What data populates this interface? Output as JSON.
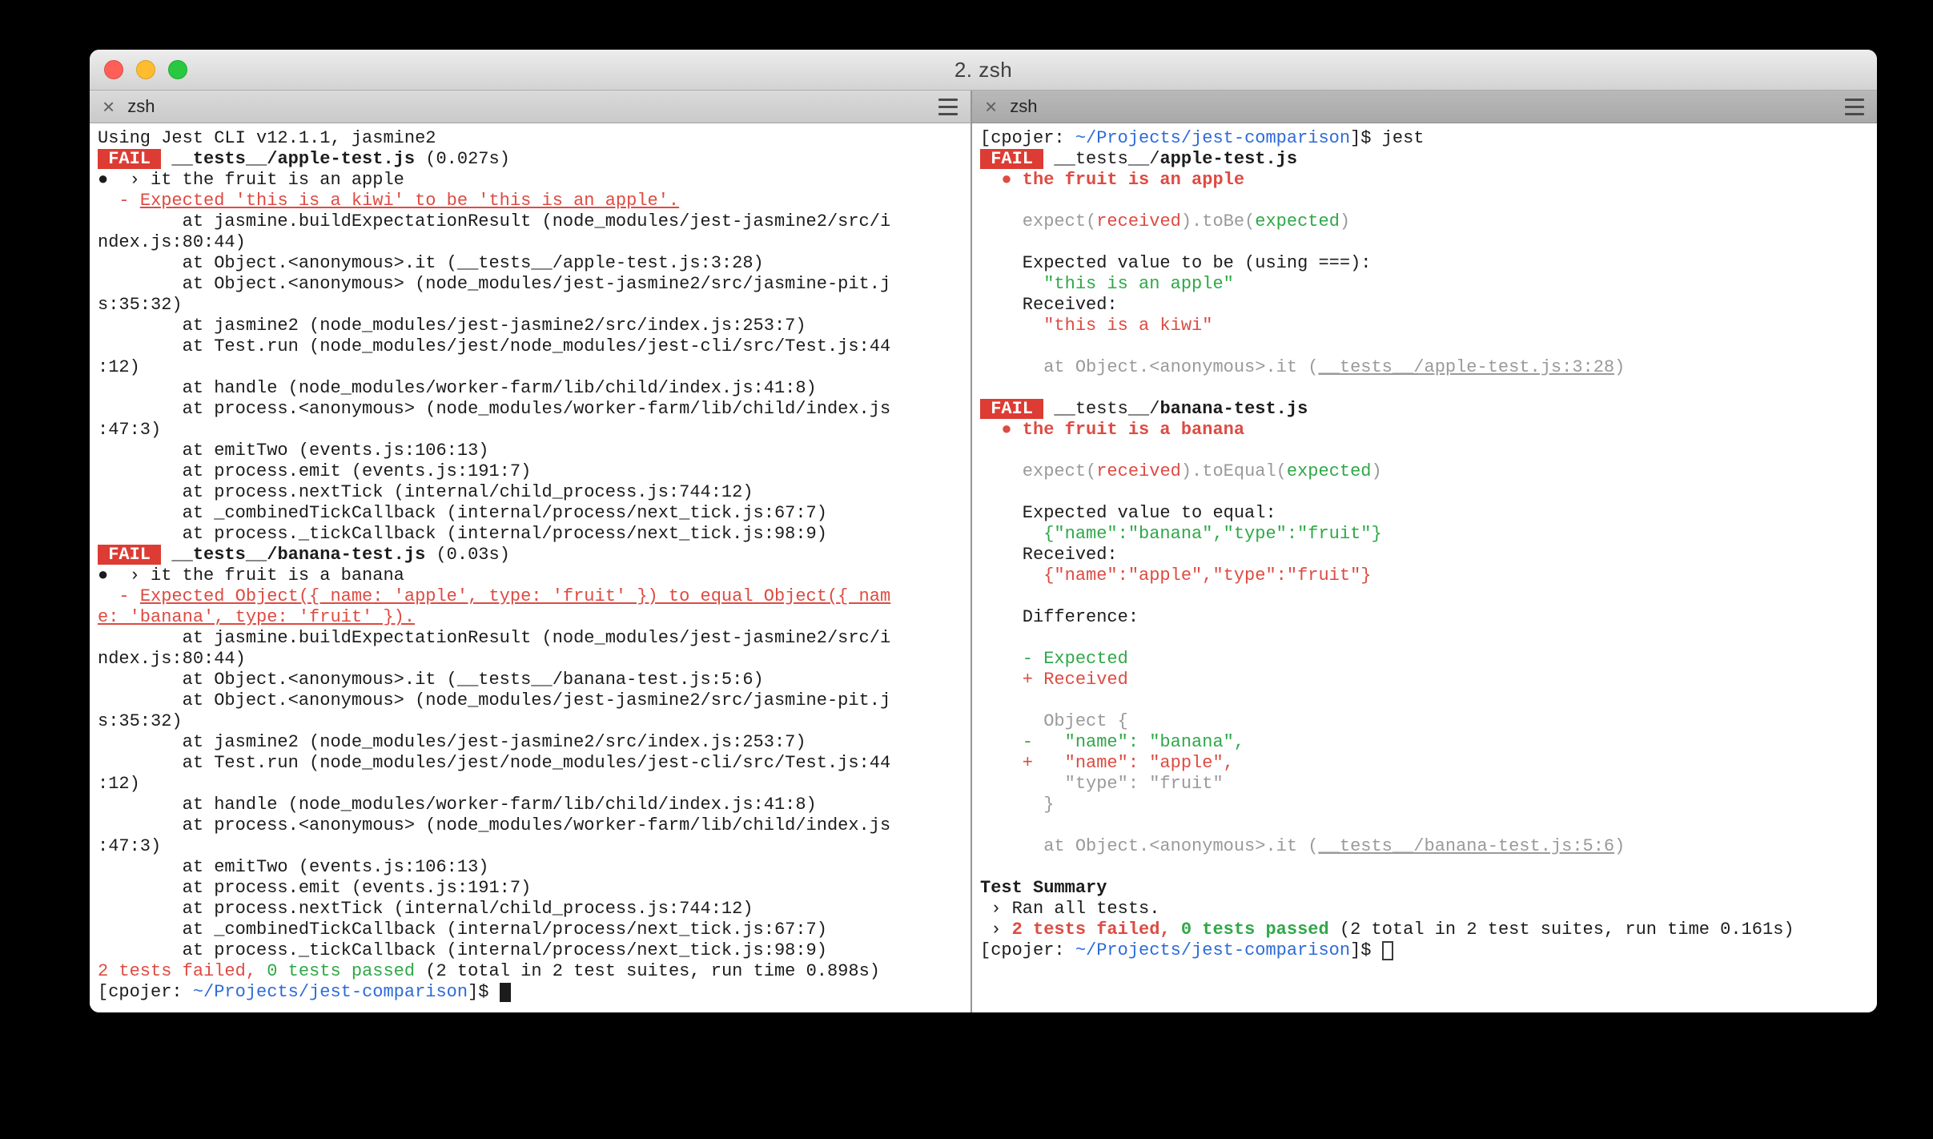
{
  "window": {
    "title": "2. zsh"
  },
  "colors": {
    "fail-badge-bg": "#dc3c33",
    "term-red": "#dd4b42",
    "term-green": "#2fa848",
    "term-blue": "#2d6bd8",
    "term-dim": "#9a9a9a",
    "term-fg": "#1c1c1c",
    "term-bg": "#ffffff",
    "traffic-red": "#ff5f57",
    "traffic-yellow": "#febc2e",
    "traffic-green": "#28c840"
  },
  "panes": {
    "left": {
      "tab": {
        "close_glyph": "×",
        "label": "zsh"
      },
      "lines": [
        [
          {
            "t": "Using Jest CLI v12.1.1, jasmine2"
          }
        ],
        [
          {
            "t": " FAIL ",
            "s": "badge"
          },
          {
            "t": " "
          },
          {
            "t": "__tests__/apple-test.js",
            "s": "bold"
          },
          {
            "t": " (0.027s)"
          }
        ],
        [
          {
            "t": "●  › it the fruit is an apple"
          }
        ],
        [
          {
            "t": "  - ",
            "s": "red"
          },
          {
            "t": "Expected 'this is a kiwi' to be 'this is an apple'.",
            "s": "red_u"
          }
        ],
        [
          {
            "t": "        at jasmine.buildExpectationResult (node_modules/jest-jasmine2/src/i"
          }
        ],
        [
          {
            "t": "ndex.js:80:44)"
          }
        ],
        [
          {
            "t": "        at Object.<anonymous>.it (__tests__/apple-test.js:3:28)"
          }
        ],
        [
          {
            "t": "        at Object.<anonymous> (node_modules/jest-jasmine2/src/jasmine-pit.j"
          }
        ],
        [
          {
            "t": "s:35:32)"
          }
        ],
        [
          {
            "t": "        at jasmine2 (node_modules/jest-jasmine2/src/index.js:253:7)"
          }
        ],
        [
          {
            "t": "        at Test.run (node_modules/jest/node_modules/jest-cli/src/Test.js:44"
          }
        ],
        [
          {
            "t": ":12)"
          }
        ],
        [
          {
            "t": "        at handle (node_modules/worker-farm/lib/child/index.js:41:8)"
          }
        ],
        [
          {
            "t": "        at process.<anonymous> (node_modules/worker-farm/lib/child/index.js"
          }
        ],
        [
          {
            "t": ":47:3)"
          }
        ],
        [
          {
            "t": "        at emitTwo (events.js:106:13)"
          }
        ],
        [
          {
            "t": "        at process.emit (events.js:191:7)"
          }
        ],
        [
          {
            "t": "        at process.nextTick (internal/child_process.js:744:12)"
          }
        ],
        [
          {
            "t": "        at _combinedTickCallback (internal/process/next_tick.js:67:7)"
          }
        ],
        [
          {
            "t": "        at process._tickCallback (internal/process/next_tick.js:98:9)"
          }
        ],
        [
          {
            "t": " FAIL ",
            "s": "badge"
          },
          {
            "t": " "
          },
          {
            "t": "__tests__/banana-test.js",
            "s": "bold"
          },
          {
            "t": " (0.03s)"
          }
        ],
        [
          {
            "t": "●  › it the fruit is a banana"
          }
        ],
        [
          {
            "t": "  - ",
            "s": "red"
          },
          {
            "t": "Expected Object({ name: 'apple', type: 'fruit' }) to equal Object({ nam",
            "s": "red_u"
          }
        ],
        [
          {
            "t": "e: 'banana', type: 'fruit' }).",
            "s": "red_u"
          }
        ],
        [
          {
            "t": "        at jasmine.buildExpectationResult (node_modules/jest-jasmine2/src/i"
          }
        ],
        [
          {
            "t": "ndex.js:80:44)"
          }
        ],
        [
          {
            "t": "        at Object.<anonymous>.it (__tests__/banana-test.js:5:6)"
          }
        ],
        [
          {
            "t": "        at Object.<anonymous> (node_modules/jest-jasmine2/src/jasmine-pit.j"
          }
        ],
        [
          {
            "t": "s:35:32)"
          }
        ],
        [
          {
            "t": "        at jasmine2 (node_modules/jest-jasmine2/src/index.js:253:7)"
          }
        ],
        [
          {
            "t": "        at Test.run (node_modules/jest/node_modules/jest-cli/src/Test.js:44"
          }
        ],
        [
          {
            "t": ":12)"
          }
        ],
        [
          {
            "t": "        at handle (node_modules/worker-farm/lib/child/index.js:41:8)"
          }
        ],
        [
          {
            "t": "        at process.<anonymous> (node_modules/worker-farm/lib/child/index.js"
          }
        ],
        [
          {
            "t": ":47:3)"
          }
        ],
        [
          {
            "t": "        at emitTwo (events.js:106:13)"
          }
        ],
        [
          {
            "t": "        at process.emit (events.js:191:7)"
          }
        ],
        [
          {
            "t": "        at process.nextTick (internal/child_process.js:744:12)"
          }
        ],
        [
          {
            "t": "        at _combinedTickCallback (internal/process/next_tick.js:67:7)"
          }
        ],
        [
          {
            "t": "        at process._tickCallback (internal/process/next_tick.js:98:9)"
          }
        ],
        [
          {
            "t": "2 tests failed,",
            "s": "red"
          },
          {
            "t": " "
          },
          {
            "t": "0 tests passed",
            "s": "green"
          },
          {
            "t": " (2 total in 2 test suites, run time 0.898s)"
          }
        ],
        [
          {
            "t": "[cpojer: "
          },
          {
            "t": "~/Projects/jest-comparison",
            "s": "blue"
          },
          {
            "t": "]$ "
          },
          {
            "t": " ",
            "s": "cursor"
          }
        ]
      ]
    },
    "right": {
      "tab": {
        "close_glyph": "×",
        "label": "zsh"
      },
      "lines": [
        [
          {
            "t": "[cpojer: "
          },
          {
            "t": "~/Projects/jest-comparison",
            "s": "blue"
          },
          {
            "t": "]$ jest"
          }
        ],
        [
          {
            "t": " FAIL ",
            "s": "badge"
          },
          {
            "t": " "
          },
          {
            "t": "__tests__/"
          },
          {
            "t": "apple-test.js",
            "s": "bold"
          }
        ],
        [
          {
            "t": "  ● the fruit is an apple",
            "s": "red_b"
          }
        ],
        [],
        [
          {
            "t": "    expect(",
            "s": "dim"
          },
          {
            "t": "received",
            "s": "red"
          },
          {
            "t": ").toBe(",
            "s": "dim"
          },
          {
            "t": "expected",
            "s": "green"
          },
          {
            "t": ")",
            "s": "dim"
          }
        ],
        [],
        [
          {
            "t": "    Expected value to be (using ===):"
          }
        ],
        [
          {
            "t": "      \"this is an apple\"",
            "s": "green"
          }
        ],
        [
          {
            "t": "    Received:"
          }
        ],
        [
          {
            "t": "      \"this is a kiwi\"",
            "s": "red"
          }
        ],
        [],
        [
          {
            "t": "      at Object.<anonymous>.it (",
            "s": "dim"
          },
          {
            "t": "__tests__/apple-test.js:3:28",
            "s": "dim_u"
          },
          {
            "t": ")",
            "s": "dim"
          }
        ],
        [],
        [
          {
            "t": " FAIL ",
            "s": "badge"
          },
          {
            "t": " "
          },
          {
            "t": "__tests__/"
          },
          {
            "t": "banana-test.js",
            "s": "bold"
          }
        ],
        [
          {
            "t": "  ● the fruit is a banana",
            "s": "red_b"
          }
        ],
        [],
        [
          {
            "t": "    expect(",
            "s": "dim"
          },
          {
            "t": "received",
            "s": "red"
          },
          {
            "t": ").toEqual(",
            "s": "dim"
          },
          {
            "t": "expected",
            "s": "green"
          },
          {
            "t": ")",
            "s": "dim"
          }
        ],
        [],
        [
          {
            "t": "    Expected value to equal:"
          }
        ],
        [
          {
            "t": "      {\"name\":\"banana\",\"type\":\"fruit\"}",
            "s": "green"
          }
        ],
        [
          {
            "t": "    Received:"
          }
        ],
        [
          {
            "t": "      {\"name\":\"apple\",\"type\":\"fruit\"}",
            "s": "red"
          }
        ],
        [],
        [
          {
            "t": "    Difference:"
          }
        ],
        [],
        [
          {
            "t": "    - Expected",
            "s": "green"
          }
        ],
        [
          {
            "t": "    + Received",
            "s": "red"
          }
        ],
        [],
        [
          {
            "t": "      Object {",
            "s": "dim"
          }
        ],
        [
          {
            "t": "    -   \"name\": \"banana\",",
            "s": "green"
          }
        ],
        [
          {
            "t": "    +   \"name\": \"apple\",",
            "s": "red"
          }
        ],
        [
          {
            "t": "        \"type\": \"fruit\"",
            "s": "dim"
          }
        ],
        [
          {
            "t": "      }",
            "s": "dim"
          }
        ],
        [],
        [
          {
            "t": "      at Object.<anonymous>.it (",
            "s": "dim"
          },
          {
            "t": "__tests__/banana-test.js:5:6",
            "s": "dim_u"
          },
          {
            "t": ")",
            "s": "dim"
          }
        ],
        [],
        [
          {
            "t": "Test Summary",
            "s": "bold"
          }
        ],
        [
          {
            "t": " › Ran all tests."
          }
        ],
        [
          {
            "t": " › "
          },
          {
            "t": "2 tests failed,",
            "s": "red_b"
          },
          {
            "t": " "
          },
          {
            "t": "0 tests passed",
            "s": "green_b"
          },
          {
            "t": " (2 total in 2 test suites, run time 0.161s)"
          }
        ],
        [
          {
            "t": "[cpojer: "
          },
          {
            "t": "~/Projects/jest-comparison",
            "s": "blue"
          },
          {
            "t": "]$ "
          },
          {
            "t": " ",
            "s": "cursor_h"
          }
        ]
      ]
    }
  }
}
